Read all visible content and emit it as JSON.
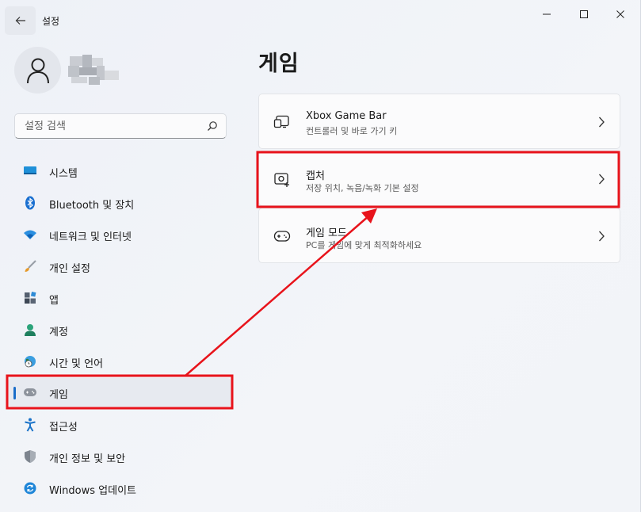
{
  "window": {
    "title": "설정"
  },
  "profile": {
    "name_hidden": ""
  },
  "search": {
    "placeholder": "설정 검색"
  },
  "nav": {
    "items": [
      {
        "key": "system",
        "label": "시스템"
      },
      {
        "key": "bluetooth",
        "label": "Bluetooth 및 장치"
      },
      {
        "key": "network",
        "label": "네트워크 및 인터넷"
      },
      {
        "key": "personalization",
        "label": "개인 설정"
      },
      {
        "key": "apps",
        "label": "앱"
      },
      {
        "key": "accounts",
        "label": "계정"
      },
      {
        "key": "time",
        "label": "시간 및 언어"
      },
      {
        "key": "gaming",
        "label": "게임"
      },
      {
        "key": "accessibility",
        "label": "접근성"
      },
      {
        "key": "privacy",
        "label": "개인 정보 및 보안"
      },
      {
        "key": "update",
        "label": "Windows 업데이트"
      }
    ],
    "active": "gaming"
  },
  "main": {
    "title": "게임",
    "cards": [
      {
        "title": "Xbox Game Bar",
        "subtitle": "컨트롤러 및 바로 가기 키"
      },
      {
        "title": "캡처",
        "subtitle": "저장 위치, 녹음/녹화 기본 설정"
      },
      {
        "title": "게임 모드",
        "subtitle": "PC를 게임에 맞게 최적화하세요"
      }
    ]
  },
  "colors": {
    "accent": "#1a6dc9",
    "annotation": "#e8131b"
  },
  "icons": {
    "back": "back-arrow-icon",
    "minimize": "minimize-icon",
    "maximize": "maximize-icon",
    "close": "close-icon",
    "search": "search-icon",
    "chevron": "chevron-right-icon"
  }
}
